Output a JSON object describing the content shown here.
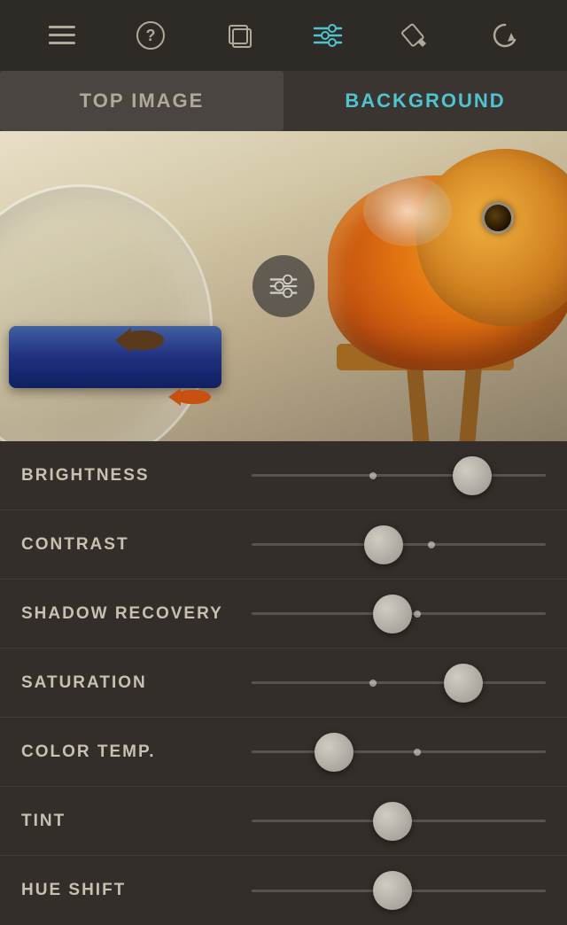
{
  "toolbar": {
    "items": [
      {
        "name": "menu-icon",
        "label": "☰",
        "active": false
      },
      {
        "name": "help-icon",
        "label": "?",
        "active": false
      },
      {
        "name": "layers-icon",
        "label": "⧉",
        "active": false
      },
      {
        "name": "sliders-icon",
        "label": "≡",
        "active": true
      },
      {
        "name": "brush-icon",
        "label": "🖌",
        "active": false
      },
      {
        "name": "reset-icon",
        "label": "↺",
        "active": false
      }
    ]
  },
  "tabs": [
    {
      "id": "top-image",
      "label": "TOP IMAGE",
      "active": false
    },
    {
      "id": "background",
      "label": "BACKGROUND",
      "active": true
    }
  ],
  "sliders_button_label": "adjustments",
  "adjustments": [
    {
      "id": "brightness",
      "label": "BRIGHTNESS",
      "value": 75,
      "center": 40
    },
    {
      "id": "contrast",
      "label": "CONTRAST",
      "value": 45,
      "center": 50
    },
    {
      "id": "shadow-recovery",
      "label": "SHADOW RECOVERY",
      "value": 48,
      "center": 48
    },
    {
      "id": "saturation",
      "label": "SATURATION",
      "value": 72,
      "center": 42
    },
    {
      "id": "color-temp",
      "label": "COLOR TEMP.",
      "value": 30,
      "center": 52
    },
    {
      "id": "tint",
      "label": "TINT",
      "value": 48,
      "center": 42
    },
    {
      "id": "hue-shift",
      "label": "HUE SHIFT",
      "value": 48,
      "center": 48
    }
  ]
}
